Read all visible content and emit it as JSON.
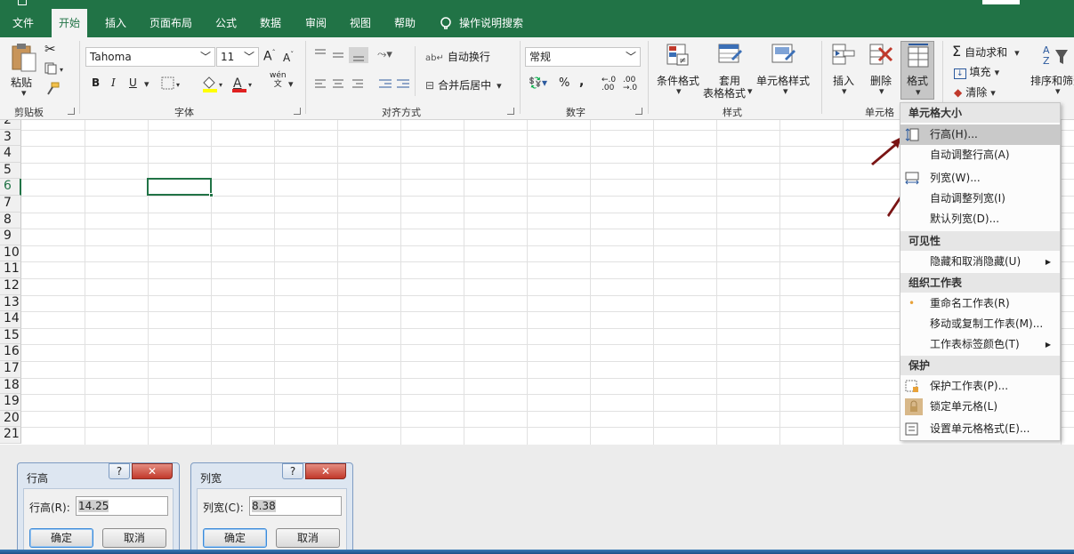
{
  "tabs": [
    "文件",
    "开始",
    "插入",
    "页面布局",
    "公式",
    "数据",
    "审阅",
    "视图",
    "帮助"
  ],
  "tell_me": "操作说明搜索",
  "clipboard": {
    "paste": "粘贴",
    "group": "剪贴板"
  },
  "font": {
    "name": "Tahoma",
    "size": "11",
    "bold": "B",
    "italic": "I",
    "underline": "U",
    "grow": "A",
    "shrink": "A",
    "color_a": "A",
    "pinyin_top": "wén",
    "pinyin_bottom": "文",
    "group": "字体"
  },
  "alignment": {
    "wrap": "自动换行",
    "merge": "合并后居中",
    "group": "对齐方式"
  },
  "number": {
    "format": "常规",
    "percent": "%",
    "comma": ",",
    "group": "数字"
  },
  "styles": {
    "conditional": "条件格式",
    "table_l1": "套用",
    "table_l2": "表格格式",
    "cell_styles": "单元格样式",
    "group": "样式"
  },
  "cells": {
    "insert": "插入",
    "delete": "删除",
    "format": "格式",
    "group": "单元格"
  },
  "editing": {
    "autosum": "自动求和",
    "fill": "填充",
    "clear": "清除",
    "sort": "排序和筛选"
  },
  "rows": [
    "2",
    "3",
    "4",
    "5",
    "6",
    "7",
    "8",
    "9",
    "10",
    "11",
    "12",
    "13",
    "14",
    "15",
    "16",
    "17",
    "18",
    "19",
    "20",
    "21"
  ],
  "menu": {
    "h1": "单元格大小",
    "row_height": "行高(H)...",
    "auto_row": "自动调整行高(A)",
    "col_width": "列宽(W)...",
    "auto_col": "自动调整列宽(I)",
    "default_width": "默认列宽(D)...",
    "h2": "可见性",
    "hide_unhide": "隐藏和取消隐藏(U)",
    "h3": "组织工作表",
    "rename": "重命名工作表(R)",
    "move_copy": "移动或复制工作表(M)...",
    "tab_color": "工作表标签颜色(T)",
    "h4": "保护",
    "protect": "保护工作表(P)...",
    "lock": "锁定单元格(L)",
    "format_cells": "设置单元格格式(E)..."
  },
  "dialog_row": {
    "title": "行高",
    "help": "?",
    "close": "✕",
    "label": "行高(R):",
    "value": "14.25",
    "ok": "确定",
    "cancel": "取消"
  },
  "dialog_col": {
    "title": "列宽",
    "help": "?",
    "close": "✕",
    "label": "列宽(C):",
    "value": "8.38",
    "ok": "确定",
    "cancel": "取消"
  },
  "colors": {
    "excel_green": "#217346",
    "arrow": "#7a1414"
  }
}
